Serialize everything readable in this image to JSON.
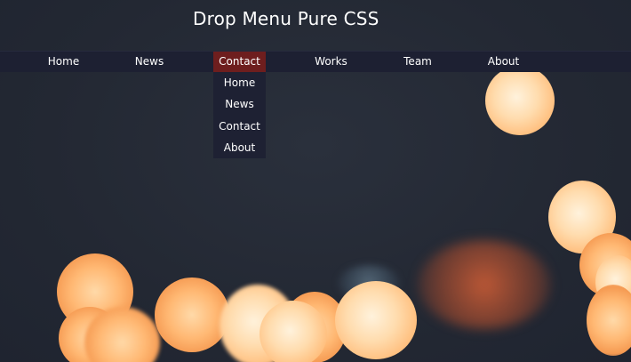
{
  "page": {
    "title": "Drop Menu Pure CSS"
  },
  "nav": {
    "items": [
      {
        "label": "Home"
      },
      {
        "label": "News"
      },
      {
        "label": "Contact",
        "active": true
      },
      {
        "label": "Works"
      },
      {
        "label": "Team"
      },
      {
        "label": "About"
      }
    ]
  },
  "dropdown": {
    "items": [
      {
        "label": "Home"
      },
      {
        "label": "News"
      },
      {
        "label": "Contact"
      },
      {
        "label": "About"
      }
    ]
  },
  "colors": {
    "background": "#252a35",
    "navbar": "#1d2032",
    "active": "#6e1e1e",
    "dropdown": "#1e2133",
    "text": "#ffffff",
    "bokeh": "#ffb873"
  }
}
